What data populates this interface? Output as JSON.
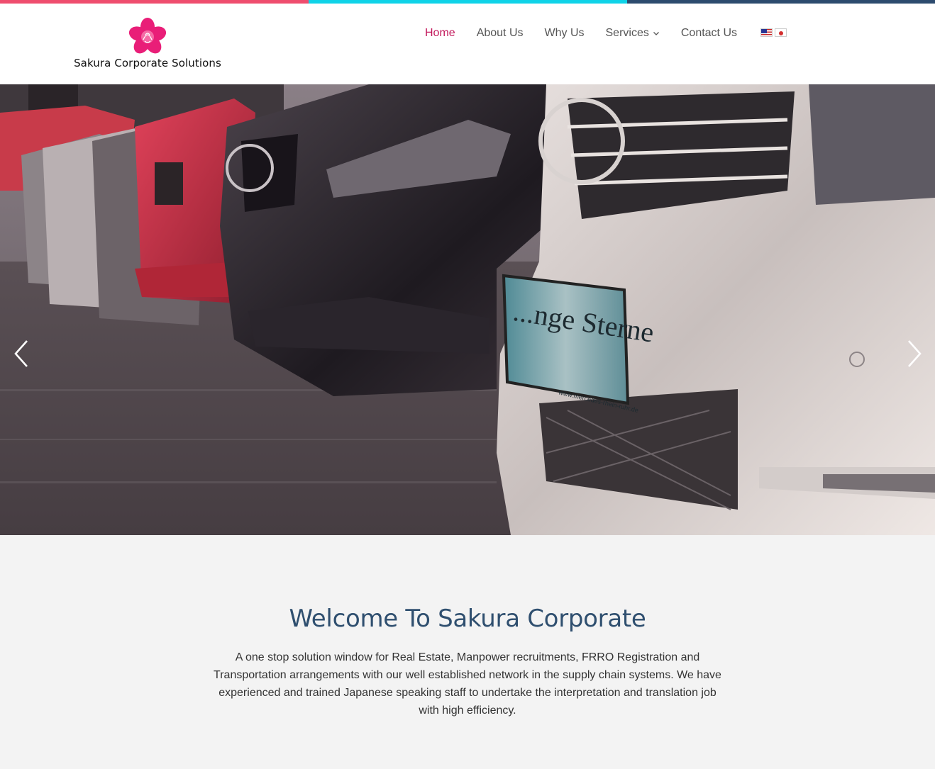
{
  "colors": {
    "stripe": [
      "#ef4d6e",
      "#0fd3e8",
      "#2c4b6e"
    ],
    "brand_pink": "#e91e78",
    "nav_active": "#c2185b",
    "heading": "#2f4f6f"
  },
  "brand": {
    "logo_icon": "sakura-flower-icon",
    "name": "Sakura Corporate Solutions"
  },
  "nav": {
    "items": [
      {
        "label": "Home",
        "active": true
      },
      {
        "label": "About Us"
      },
      {
        "label": "Why Us"
      },
      {
        "label": "Services",
        "has_dropdown": true
      },
      {
        "label": "Contact Us"
      }
    ],
    "languages": [
      "us-flag-icon",
      "japan-flag-icon"
    ]
  },
  "hero": {
    "image": "row of parked cars",
    "prev_icon": "chevron-left-icon",
    "next_icon": "chevron-right-icon",
    "plate_text": "...nge Sterne",
    "plate_subtext": "www.mercedes-rhein-ruhr.de"
  },
  "welcome": {
    "title": "Welcome To Sakura Corporate",
    "body": "A one stop solution window for Real Estate, Manpower recruitments, FRRO Registration and Transportation arrangements with our well established  network in the supply chain systems. We have experienced and trained Japanese speaking staff to undertake the interpretation and translation job with high efficiency."
  }
}
